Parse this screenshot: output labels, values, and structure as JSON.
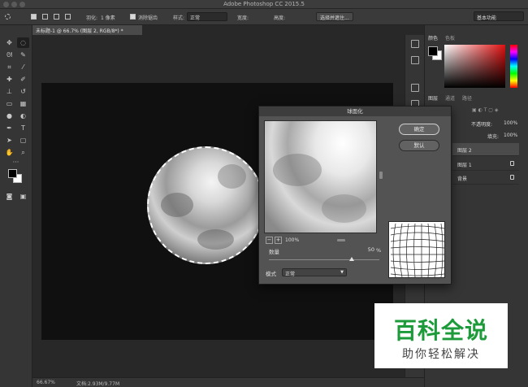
{
  "window": {
    "title": "Adobe Photoshop CC 2015.5"
  },
  "options_bar": {
    "feather_label": "羽化:",
    "feather_value": "1 像素",
    "antialias_label": "消除锯齿",
    "style_label": "样式:",
    "style_value": "正常",
    "width_label": "宽度:",
    "height_label": "高度:",
    "select_mask_button": "选择并遮住...",
    "workspace": "基本功能"
  },
  "document": {
    "tab_label": "未标题-1 @ 66.7% (图层 2, RGB/8*) *",
    "zoom_status": "66.67%",
    "doc_size": "文档:2.93M/9.77M"
  },
  "panels": {
    "color_tabs": [
      "颜色",
      "色板"
    ],
    "layers_tabs": [
      "图层",
      "通道",
      "路径"
    ],
    "opacity_label": "不透明度:",
    "opacity_value": "100%",
    "fill_label": "填充:",
    "fill_value": "100%",
    "layers": [
      {
        "name": "图层 2",
        "selected": true,
        "locked": false
      },
      {
        "name": "图层 1",
        "selected": false,
        "locked": true
      },
      {
        "name": "背景",
        "selected": false,
        "locked": true
      }
    ]
  },
  "dialog": {
    "title": "球面化",
    "ok": "确定",
    "default": "默认",
    "zoom_out": "−",
    "zoom_in": "+",
    "zoom_value": "100%",
    "amount_label": "数量",
    "amount_value": "50",
    "amount_unit": "%",
    "amount_percent": 50,
    "mode_label": "模式",
    "mode_value": "正常"
  },
  "watermark": {
    "main": "百科全说",
    "sub": "助你轻松解决"
  },
  "colors": {
    "accent_green": "#1d9b3a",
    "bg_dark": "#282828",
    "panel": "#353535"
  }
}
